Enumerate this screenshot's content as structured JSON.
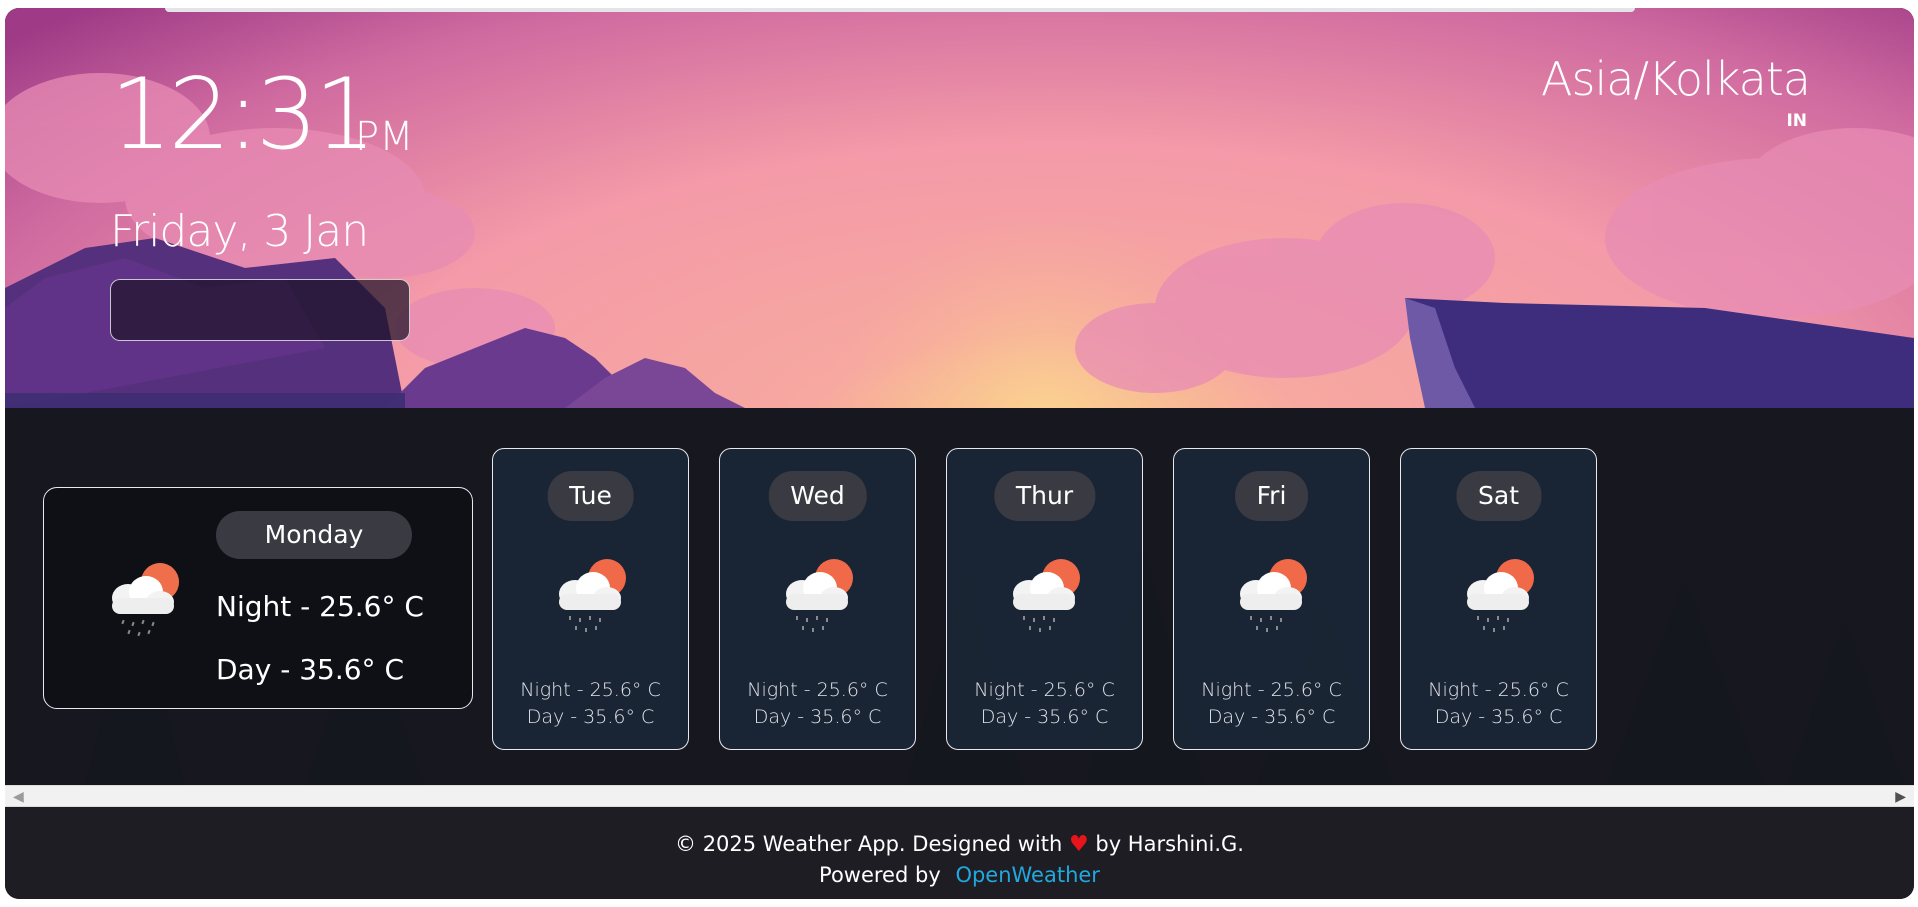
{
  "clock": {
    "time": "12:31",
    "ampm": "PM",
    "date": "Friday, 3 Jan"
  },
  "location": {
    "timezone": "Asia/Kolkata",
    "country": "IN"
  },
  "today": {
    "day": "Monday",
    "night": "Night - 25.6° C",
    "day_temp": "Day - 35.6° C",
    "icon": "cloud-rain-sun-icon"
  },
  "forecast": [
    {
      "day": "Tue",
      "night": "Night - 25.6° C",
      "day_temp": "Day - 35.6° C",
      "icon": "cloud-rain-sun-icon"
    },
    {
      "day": "Wed",
      "night": "Night - 25.6° C",
      "day_temp": "Day - 35.6° C",
      "icon": "cloud-rain-sun-icon"
    },
    {
      "day": "Thur",
      "night": "Night - 25.6° C",
      "day_temp": "Day - 35.6° C",
      "icon": "cloud-rain-sun-icon"
    },
    {
      "day": "Fri",
      "night": "Night - 25.6° C",
      "day_temp": "Day - 35.6° C",
      "icon": "cloud-rain-sun-icon"
    },
    {
      "day": "Sat",
      "night": "Night - 25.6° C",
      "day_temp": "Day - 35.6° C",
      "icon": "cloud-rain-sun-icon"
    }
  ],
  "footer": {
    "copyright": "© 2025 Weather App. Designed with",
    "heart": "♥",
    "author": "by Harshini.G.",
    "powered_by": "Powered by",
    "link_text": "OpenWeather"
  },
  "colors": {
    "sky_top": "#a53a84",
    "sky_center": "#f6a0a4",
    "sun": "#f8c07a",
    "mountain": "#4b2b86",
    "link": "#21a8e0",
    "heart": "#e8141c",
    "footer_bg": "#1d1d23"
  }
}
